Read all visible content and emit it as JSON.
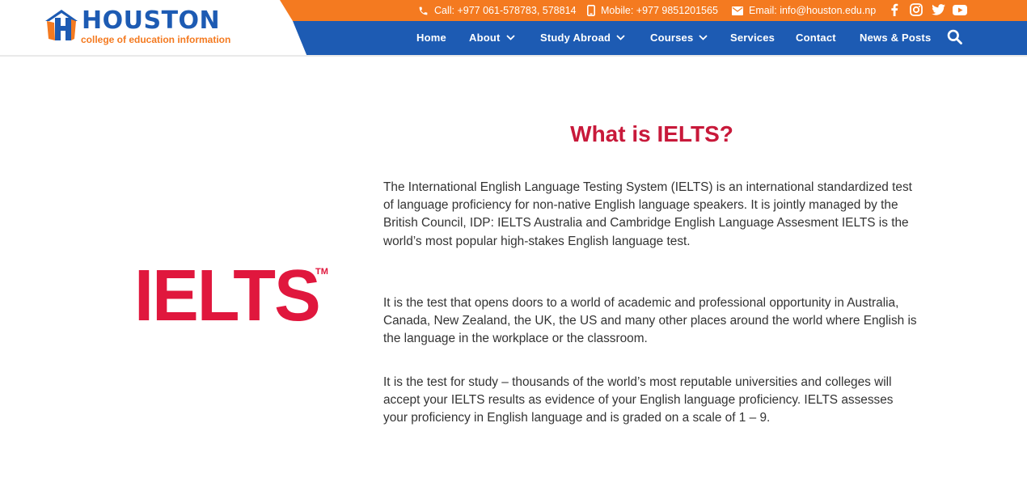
{
  "brand": {
    "name": "HOUSTON",
    "tagline": "college of education information",
    "colors": {
      "primary": "#1d5bb3",
      "accent": "#f47a20",
      "headline": "#c8193a",
      "ielts_red": "#e0173d"
    }
  },
  "topbar": {
    "call": {
      "icon": "phone-icon",
      "text": "Call: +977 061-578783, 578814"
    },
    "mobile": {
      "icon": "mobile-icon",
      "text": "Mobile: +977 9851201565"
    },
    "email": {
      "icon": "envelope-icon",
      "text": "Email: info@houston.edu.np"
    },
    "social": [
      "facebook-icon",
      "instagram-icon",
      "twitter-icon",
      "youtube-icon"
    ]
  },
  "nav": {
    "items": [
      {
        "label": "Home",
        "dropdown": false
      },
      {
        "label": "About",
        "dropdown": true
      },
      {
        "label": "Study Abroad",
        "dropdown": true
      },
      {
        "label": "Courses",
        "dropdown": true
      },
      {
        "label": "Services",
        "dropdown": false
      },
      {
        "label": "Contact",
        "dropdown": false
      },
      {
        "label": "News & Posts",
        "dropdown": false
      }
    ],
    "search_icon": "search-icon"
  },
  "main": {
    "logo_text": "IELTS",
    "logo_tm": "TM",
    "title": "What is IELTS?",
    "paragraphs": [
      "The International English Language Testing System (IELTS) is an international standardized test of language proficiency for non-native English language speakers. It is jointly managed by the British Council, IDP: IELTS Australia and Cambridge English Language Assesment IELTS is the world’s most popular high-stakes English language test.",
      "It is the test that opens doors to a world of academic and professional opportunity in Australia, Canada, New Zealand, the UK, the US and many other places around the world where English is the language in the workplace or the classroom.",
      "It is the test for study – thousands of the world’s most reputable universities and colleges will accept your IELTS results as evidence of your English language proficiency. IELTS assesses your proficiency in English language and is graded on a scale of 1 – 9."
    ]
  }
}
